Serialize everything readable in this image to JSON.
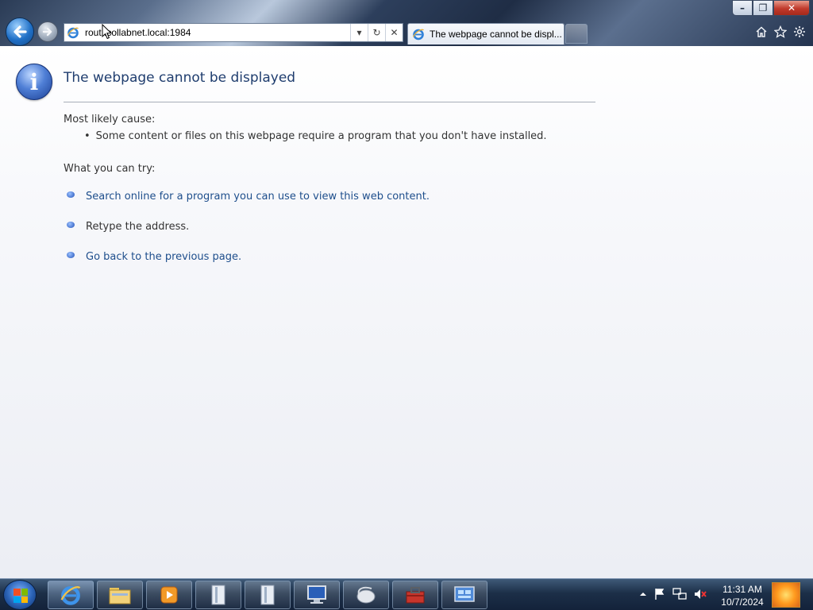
{
  "window": {
    "controls": {
      "minimize": "–",
      "maximize": "❐",
      "close": "✕"
    }
  },
  "nav": {
    "back_icon": "back-arrow-icon",
    "forward_icon": "forward-arrow-icon"
  },
  "address_bar": {
    "value": "rout .collabnet.local:1984",
    "dropdown": "▾",
    "refresh": "↻",
    "stop": "✕"
  },
  "tabs": [
    {
      "label": "The webpage cannot be displ...",
      "active": true
    }
  ],
  "command_icons": [
    "home-icon",
    "favorites-icon",
    "tools-gear-icon"
  ],
  "page": {
    "title": "The webpage cannot be displayed",
    "cause_heading": "Most likely cause:",
    "cause_bullet": "•",
    "cause_item": "Some content or files on this webpage require a program that you don't have installed.",
    "try_heading": "What you can try:",
    "try_items": [
      {
        "text": "Search online for a program you can use to view this web content.",
        "link": true
      },
      {
        "text": "Retype the address.",
        "link": false
      },
      {
        "text": "Go back to the previous page.",
        "link": true
      }
    ]
  },
  "taskbar": {
    "pinned": [
      "internet-explorer",
      "windows-explorer",
      "media-player",
      "app-window-1",
      "app-window-2",
      "remote-desktop",
      "mouse-settings",
      "toolbox",
      "control-panel"
    ],
    "tray_icons": [
      "show-hidden-icons",
      "action-center-flag",
      "network",
      "volume-muted"
    ],
    "time": "11:31 AM",
    "date": "10/7/2024"
  },
  "colors": {
    "link": "#1e4e8c",
    "title": "#1f3d6e",
    "text": "#333333"
  }
}
